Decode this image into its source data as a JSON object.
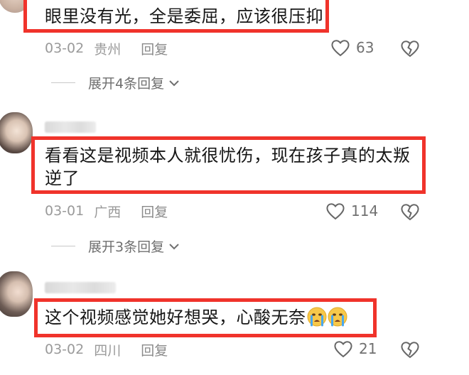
{
  "comments": [
    {
      "text_lines": [
        "眼里没有光，全是委屈，应该很压抑"
      ],
      "date": "03-02",
      "location": "贵州",
      "reply_label": "回复",
      "likes": "63",
      "expand_label": "展开4条回复"
    },
    {
      "text_lines": [
        "看看这是视频本人就很忧伤，现在孩子真的太叛",
        "逆了"
      ],
      "date": "03-01",
      "location": "广西",
      "reply_label": "回复",
      "likes": "114",
      "expand_label": "展开3条回复"
    },
    {
      "text_lines": [
        "这个视频感觉她好想哭，心酸无奈"
      ],
      "emoji": "crying-face-emoji",
      "date": "03-02",
      "location": "四川",
      "reply_label": "回复",
      "likes": "21"
    }
  ],
  "icons": {
    "like": "heart-outline-icon",
    "dislike": "broken-heart-icon",
    "expand": "chevron-down-icon"
  },
  "colors": {
    "highlight_border": "#f0332b",
    "meta_text": "#9a9a9a",
    "comment_text": "#161616"
  }
}
